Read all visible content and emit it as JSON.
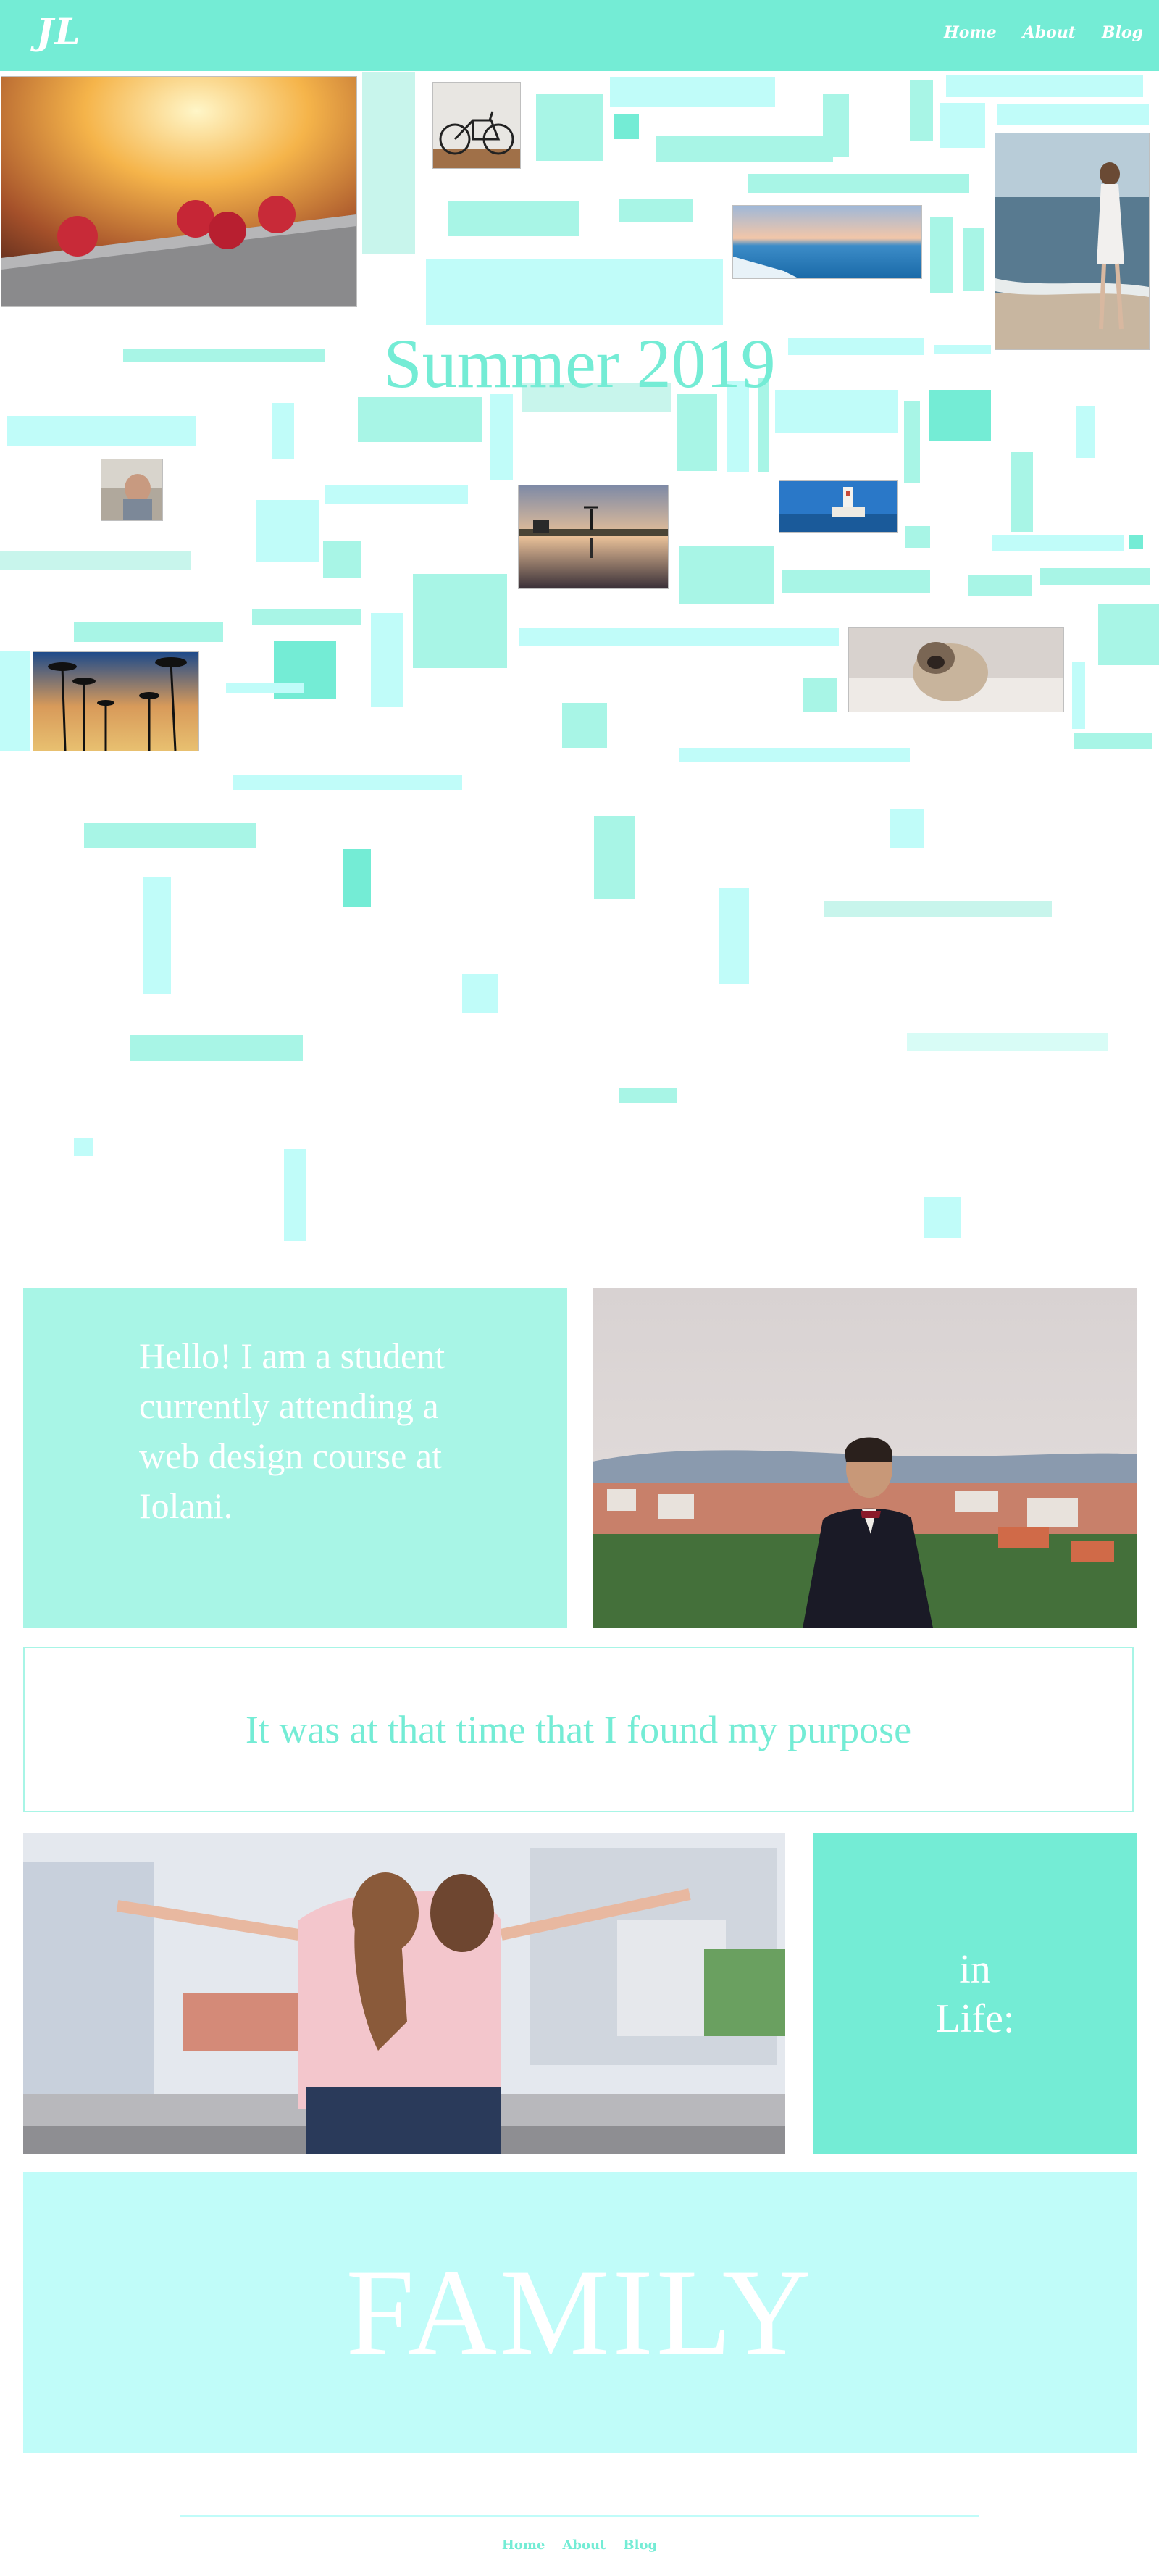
{
  "nav": {
    "logo": "JL",
    "links": [
      "Home",
      "About",
      "Blog"
    ]
  },
  "collage": {
    "title": "Summer 2019"
  },
  "hello": {
    "text": "Hello! I am a student currently attending a web design course at Iolani."
  },
  "purpose": {
    "text": "It was at that time that I found my purpose"
  },
  "inlife": {
    "line1": "in",
    "line2": "Life:"
  },
  "family": {
    "text": "FAMILY"
  },
  "footer": {
    "links": [
      "Home",
      "About",
      "Blog"
    ]
  },
  "colors": {
    "accent": "#74ecd5",
    "accent_light": "#a8f5e6",
    "accent_pale": "#c0fcf9",
    "background": "#ffffff"
  }
}
